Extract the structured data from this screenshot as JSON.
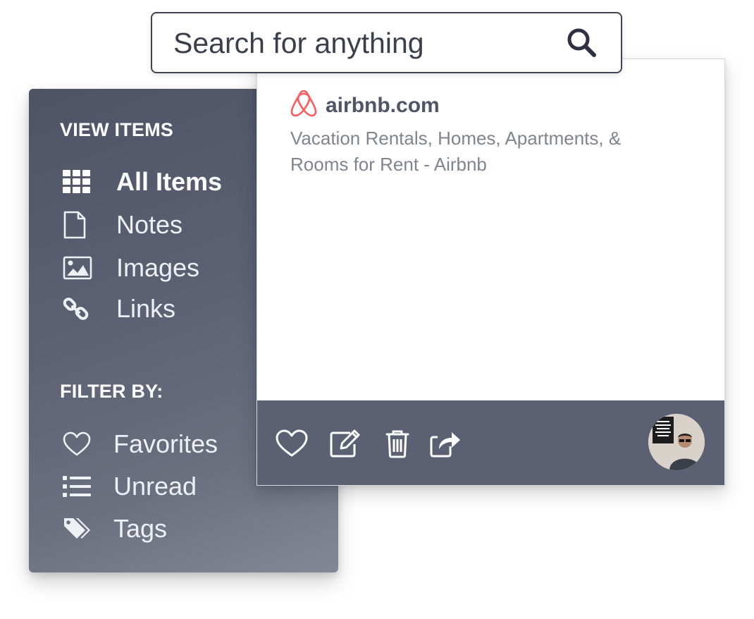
{
  "search": {
    "placeholder": "Search for anything",
    "value": ""
  },
  "sidebar": {
    "view_label": "VIEW ITEMS",
    "view_items": [
      {
        "label": "All Items",
        "icon": "grid-icon",
        "active": true
      },
      {
        "label": "Notes",
        "icon": "document-icon",
        "active": false
      },
      {
        "label": "Images",
        "icon": "image-icon",
        "active": false
      },
      {
        "label": "Links",
        "icon": "link-icon",
        "active": false
      }
    ],
    "filter_label": "FILTER BY:",
    "filter_items": [
      {
        "label": "Favorites",
        "icon": "heart-icon"
      },
      {
        "label": "Unread",
        "icon": "list-icon"
      },
      {
        "label": "Tags",
        "icon": "tags-icon"
      }
    ]
  },
  "result": {
    "domain": "airbnb.com",
    "icon": "airbnb-logo-icon",
    "description": "Vacation Rentals, Homes, Apartments, & Rooms for Rent - Airbnb"
  },
  "actions": [
    {
      "icon": "heart-icon"
    },
    {
      "icon": "edit-icon"
    },
    {
      "icon": "trash-icon"
    },
    {
      "icon": "share-icon"
    }
  ],
  "colors": {
    "sidebar": "#5c6274",
    "footer": "#5b6173",
    "airbnb_brand": "#ff5a5f",
    "domain_text": "#4f5567",
    "description_text": "#80848f"
  }
}
